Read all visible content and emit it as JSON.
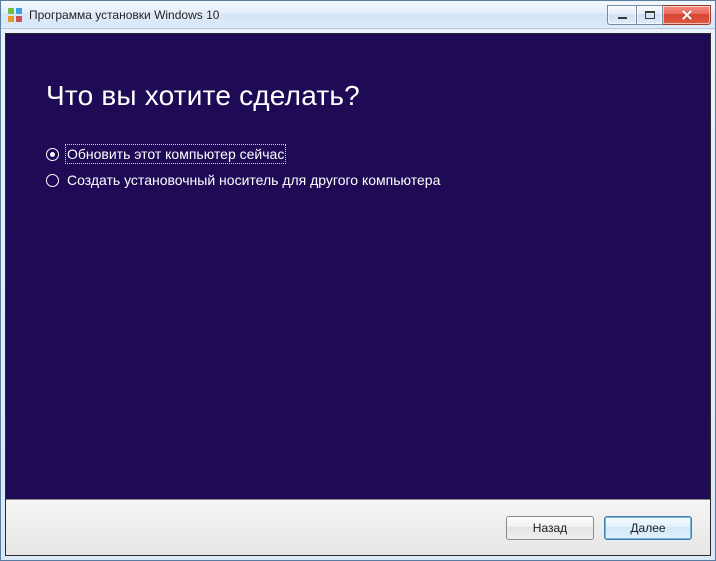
{
  "window": {
    "title": "Программа установки Windows 10"
  },
  "main": {
    "heading": "Что вы хотите сделать?",
    "options": [
      {
        "label": "Обновить этот компьютер сейчас",
        "selected": true
      },
      {
        "label": "Создать установочный носитель для другого компьютера",
        "selected": false
      }
    ]
  },
  "footer": {
    "back_label": "Назад",
    "next_label": "Далее"
  }
}
